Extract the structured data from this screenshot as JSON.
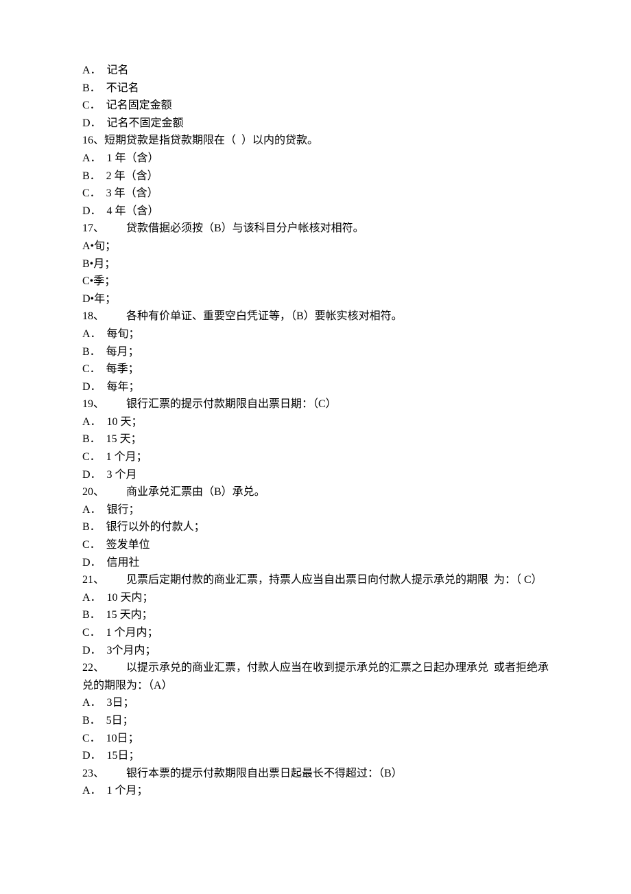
{
  "lines": [
    "A．  记名",
    "B．  不记名",
    "C．  记名固定金额",
    "D．  记名不固定金额",
    "16、短期贷款是指贷款期限在（  ）以内的贷款。",
    "A．  1 年（含）",
    "B．  2 年（含）",
    "C．  3 年（含）",
    "D．  4 年（含）",
    "17、        贷款借据必须按（B）与该科目分户帐核对相符。",
    "A•旬；",
    "B•月；",
    "C•季；",
    "D•年；",
    "18、        各种有价单证、重要空白凭证等，（B）要帐实核对相符。",
    "A．  每旬；",
    "B．  每月；",
    "C．  每季；",
    "D．  每年；",
    "19、        银行汇票的提示付款期限自出票日期：（C）",
    "A．  10 天；",
    "B．  15 天；",
    "C．  1 个月；",
    "D．  3 个月",
    "20、        商业承兑汇票由（B）承兑。",
    "A．  银行；",
    "B．  银行以外的付款人；",
    "C．  签发单位",
    "D．  信用社",
    "21、        见票后定期付款的商业汇票，持票人应当自出票日向付款人提示承兑的期限  为：（ C）",
    "A．  10 天内；",
    "B．  15 天内；",
    "C．  1 个月内；",
    "D．  3个月内；",
    "22、        以提示承兑的商业汇票，付款人应当在收到提示承兑的汇票之日起办理承兑  或者拒绝承兑的期限为：（A）",
    "A．  3日；",
    "B．  5日；",
    "C．  10日；",
    "D．  15日；",
    "23、        银行本票的提示付款期限自出票日起最长不得超过：（B）",
    "A．  1 个月；"
  ]
}
